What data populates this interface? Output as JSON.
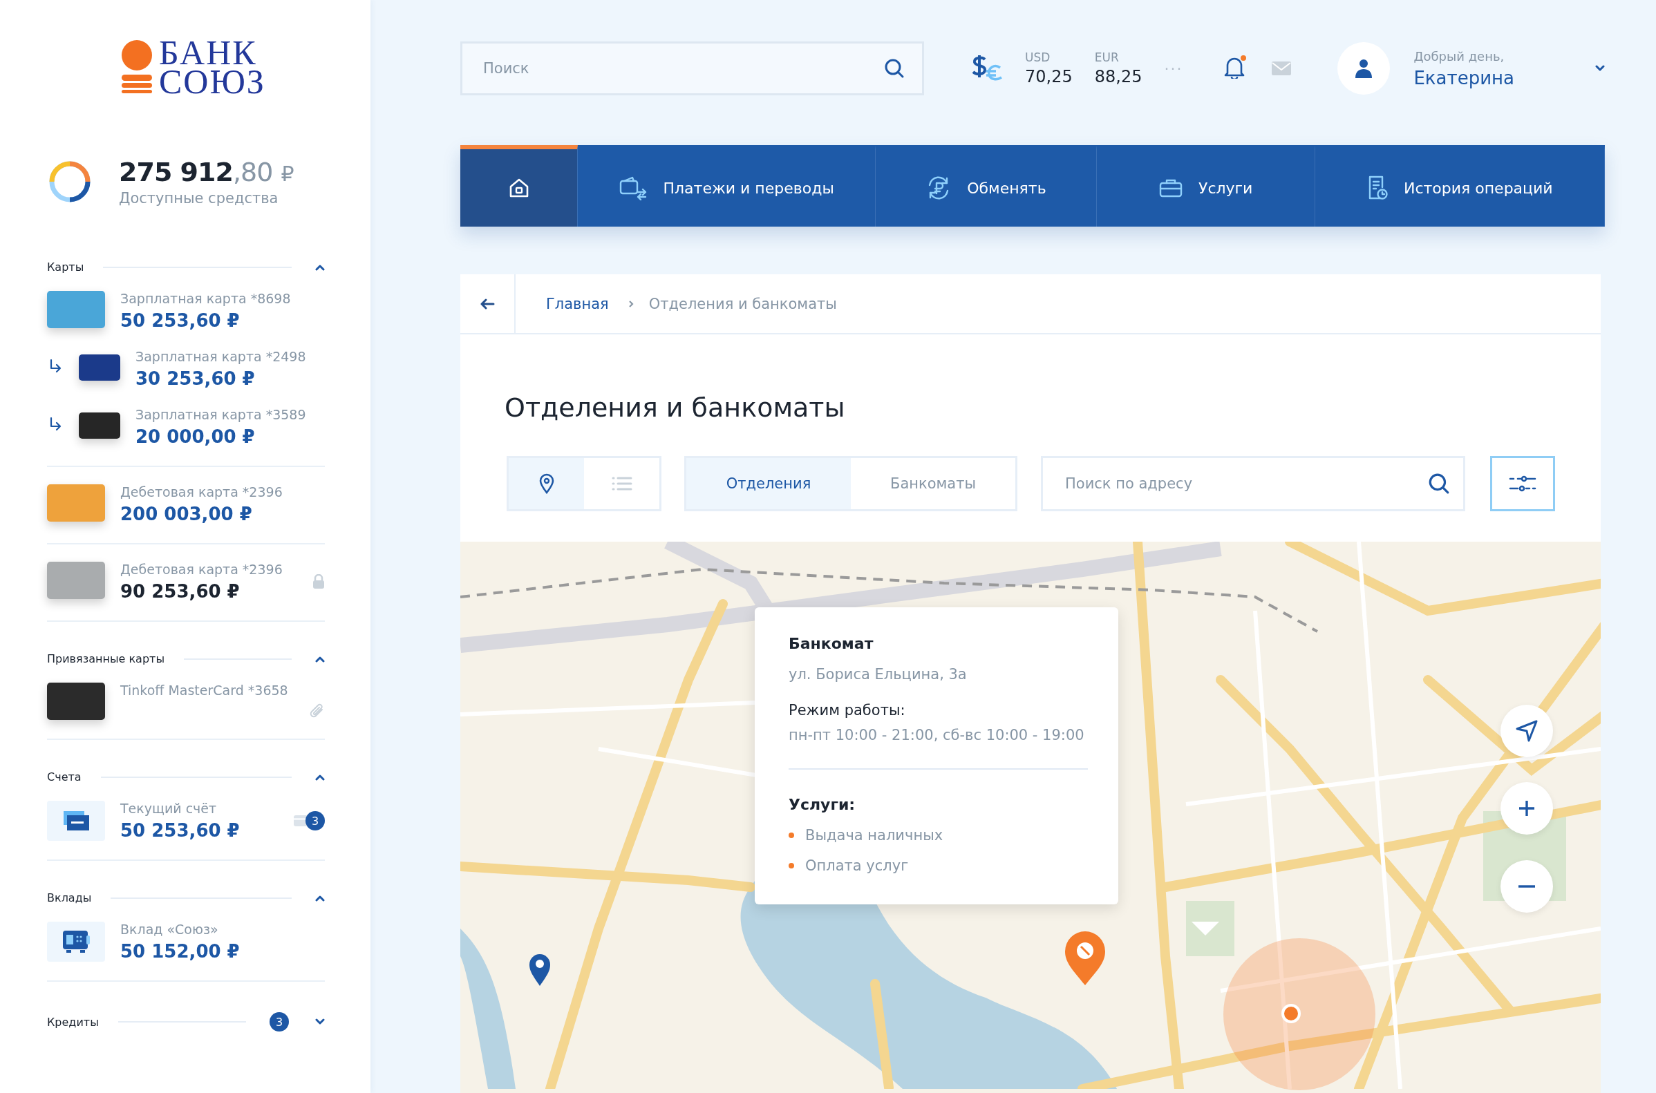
{
  "logo": {
    "line1": "БАНК",
    "line2": "СОЮЗ"
  },
  "balance": {
    "integer": "275 912",
    "fraction": ",80",
    "currency": "₽",
    "caption": "Доступные средства"
  },
  "sidebar_sections": [
    {
      "title": "Карты",
      "expanded": true,
      "groups": [
        [
          {
            "kind": "card",
            "name": "Зарплатная карта *8698",
            "amount": "50 253,60 ₽",
            "sub": false,
            "locked": false,
            "color": "#4aa6d8"
          },
          {
            "kind": "card",
            "name": "Зарплатная карта *2498",
            "amount": "30 253,60 ₽",
            "sub": true,
            "locked": false,
            "color": "#1b3a8a"
          },
          {
            "kind": "card",
            "name": "Зарплатная карта *3589",
            "amount": "20 000,00 ₽",
            "sub": true,
            "locked": false,
            "color": "#262626"
          }
        ],
        [
          {
            "kind": "card",
            "name": "Дебетовая карта *2396",
            "amount": "200 003,00 ₽",
            "sub": false,
            "locked": false,
            "color": "#eea23c"
          }
        ],
        [
          {
            "kind": "card",
            "name": "Дебетовая карта *2396",
            "amount": "90 253,60 ₽",
            "sub": false,
            "locked": true,
            "color": "#a9acae"
          }
        ]
      ]
    },
    {
      "title": "Привязанные карты",
      "expanded": true,
      "groups": [
        [
          {
            "kind": "linked_card",
            "name": "Tinkoff MasterCard *3658",
            "sub": false,
            "locked": false,
            "color": "#2b2b2b"
          }
        ]
      ]
    },
    {
      "title": "Счета",
      "expanded": true,
      "groups": [
        [
          {
            "kind": "account",
            "name": "Текущий счёт",
            "amount": "50 253,60 ₽",
            "sub": false,
            "locked": false,
            "badge": "3"
          }
        ]
      ]
    },
    {
      "title": "Вклады",
      "expanded": true,
      "groups": [
        [
          {
            "kind": "deposit",
            "name": "Вклад «Союз»",
            "amount": "50 152,00 ₽",
            "sub": false,
            "locked": false
          }
        ]
      ]
    },
    {
      "title": "Кредиты",
      "expanded": false,
      "badge": "3"
    }
  ],
  "header": {
    "search": {
      "placeholder": "Поиск"
    },
    "rates": [
      {
        "code": "USD",
        "value": "70,25"
      },
      {
        "code": "EUR",
        "value": "88,25"
      }
    ],
    "more": "···",
    "notifications_unread": true,
    "greeting": "Добрый день,",
    "user": "Екатерина"
  },
  "nav": [
    {
      "selected": true
    },
    {
      "label": "Платежи и переводы",
      "selected": false
    },
    {
      "label": "Обменять",
      "selected": false
    },
    {
      "label": "Услуги",
      "selected": false
    },
    {
      "label": "История операций",
      "selected": false
    }
  ],
  "breadcrumb": [
    "Главная",
    "Отделения и банкоматы"
  ],
  "title": "Отделения и банкоматы",
  "view_toggle": [
    {
      "selected": true
    },
    {
      "selected": false
    }
  ],
  "type_tabs": [
    {
      "label": "Отделения",
      "selected": true
    },
    {
      "label": "Банкоматы",
      "selected": false
    }
  ],
  "address_search": {
    "placeholder": "Поиск по адресу"
  },
  "popup": {
    "title": "Банкомат",
    "address": "ул. Бориса Ельцина, 3а",
    "hours_label": "Режим работы:",
    "hours": "пн-пт 10:00 - 21:00, сб-вс 10:00 - 19:00",
    "services_label": "Услуги:",
    "services": [
      "Выдача наличных",
      "Оплата услуг"
    ]
  }
}
